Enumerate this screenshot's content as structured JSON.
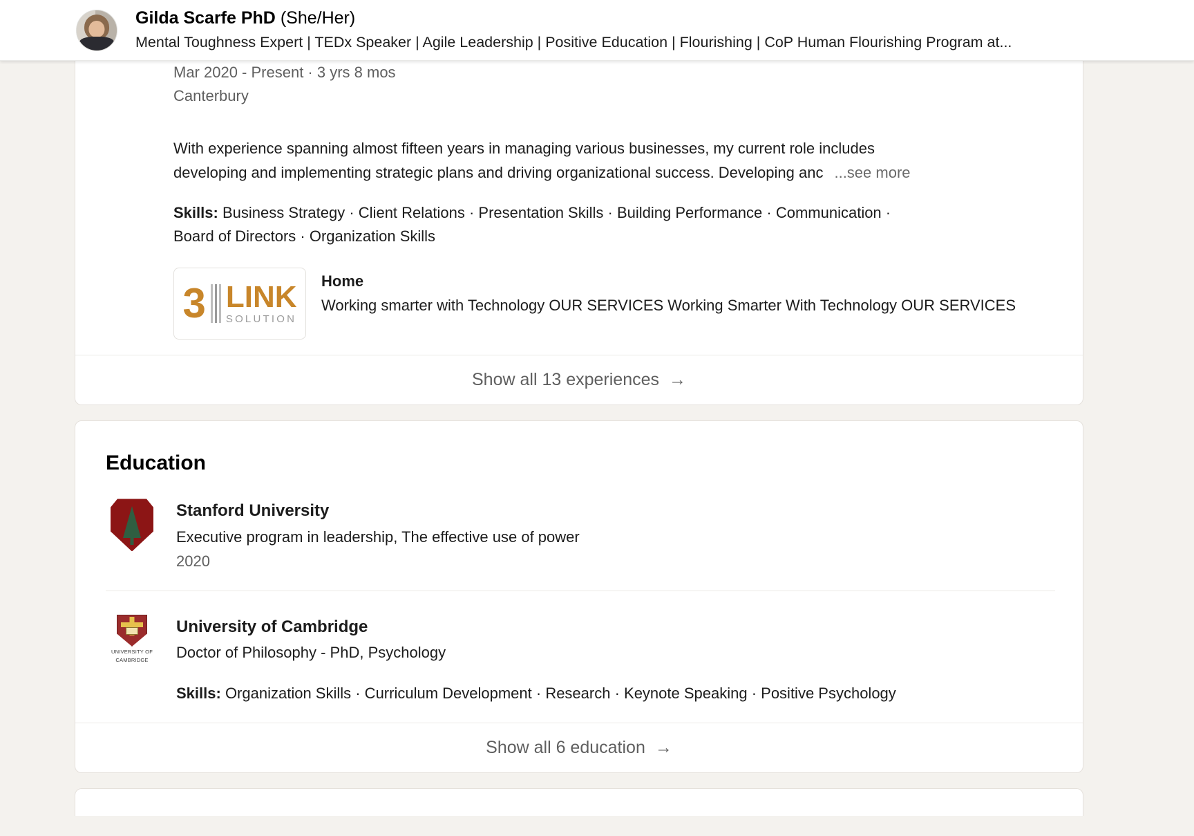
{
  "header": {
    "name": "Gilda Scarfe PhD",
    "pronouns": "(She/Her)",
    "headline": "Mental Toughness Expert | TEDx Speaker | Agile Leadership | Positive Education | Flourishing | CoP Human Flourishing Program at...",
    "avatar_icon": "profile-photo"
  },
  "experience": {
    "date_range": "Mar 2020 - Present · 3 yrs 8 mos",
    "location": "Canterbury",
    "description_line1": "With experience spanning almost fifteen years in managing various businesses, my current role includes",
    "description_line2": "developing and implementing strategic plans and driving organizational success. Developing anc",
    "see_more": "...see more",
    "skills_label": "Skills:",
    "skills_line1": "Business Strategy · Client Relations · Presentation Skills · Building Performance · Communication ·",
    "skills_line2": "Board of Directors · Organization Skills",
    "media": {
      "logo_number": "3",
      "logo_word": "LINK",
      "logo_sub": "SOLUTION",
      "title": "Home",
      "description": "Working smarter with Technology OUR SERVICES Working Smarter With Technology OUR SERVICES"
    },
    "show_all_label": "Show all 13 experiences",
    "show_all_arrow": "→"
  },
  "education": {
    "section_title": "Education",
    "items": [
      {
        "logo_icon": "stanford-shield-icon",
        "school": "Stanford University",
        "degree": "Executive program in leadership, The effective use of power",
        "years": "2020",
        "skills_label": "",
        "skills": ""
      },
      {
        "logo_icon": "cambridge-crest-icon",
        "school": "University of Cambridge",
        "degree": "Doctor of Philosophy - PhD, Psychology",
        "years": "",
        "skills_label": "Skills:",
        "skills": "Organization Skills · Curriculum Development · Research · Keynote Speaking · Positive Psychology"
      }
    ],
    "cambridge_logo_text_line1": "UNIVERSITY OF",
    "cambridge_logo_text_line2": "CAMBRIDGE",
    "show_all_label": "Show all 6 education",
    "show_all_arrow": "→"
  },
  "colors": {
    "page_bg": "#f4f2ee",
    "card_bg": "#ffffff",
    "text_primary": "#1c1c1c",
    "text_secondary": "#5f5f5f",
    "logo_orange": "#c8862a",
    "stanford_red": "#8c1515",
    "cambridge_red": "#9b2c2c"
  }
}
